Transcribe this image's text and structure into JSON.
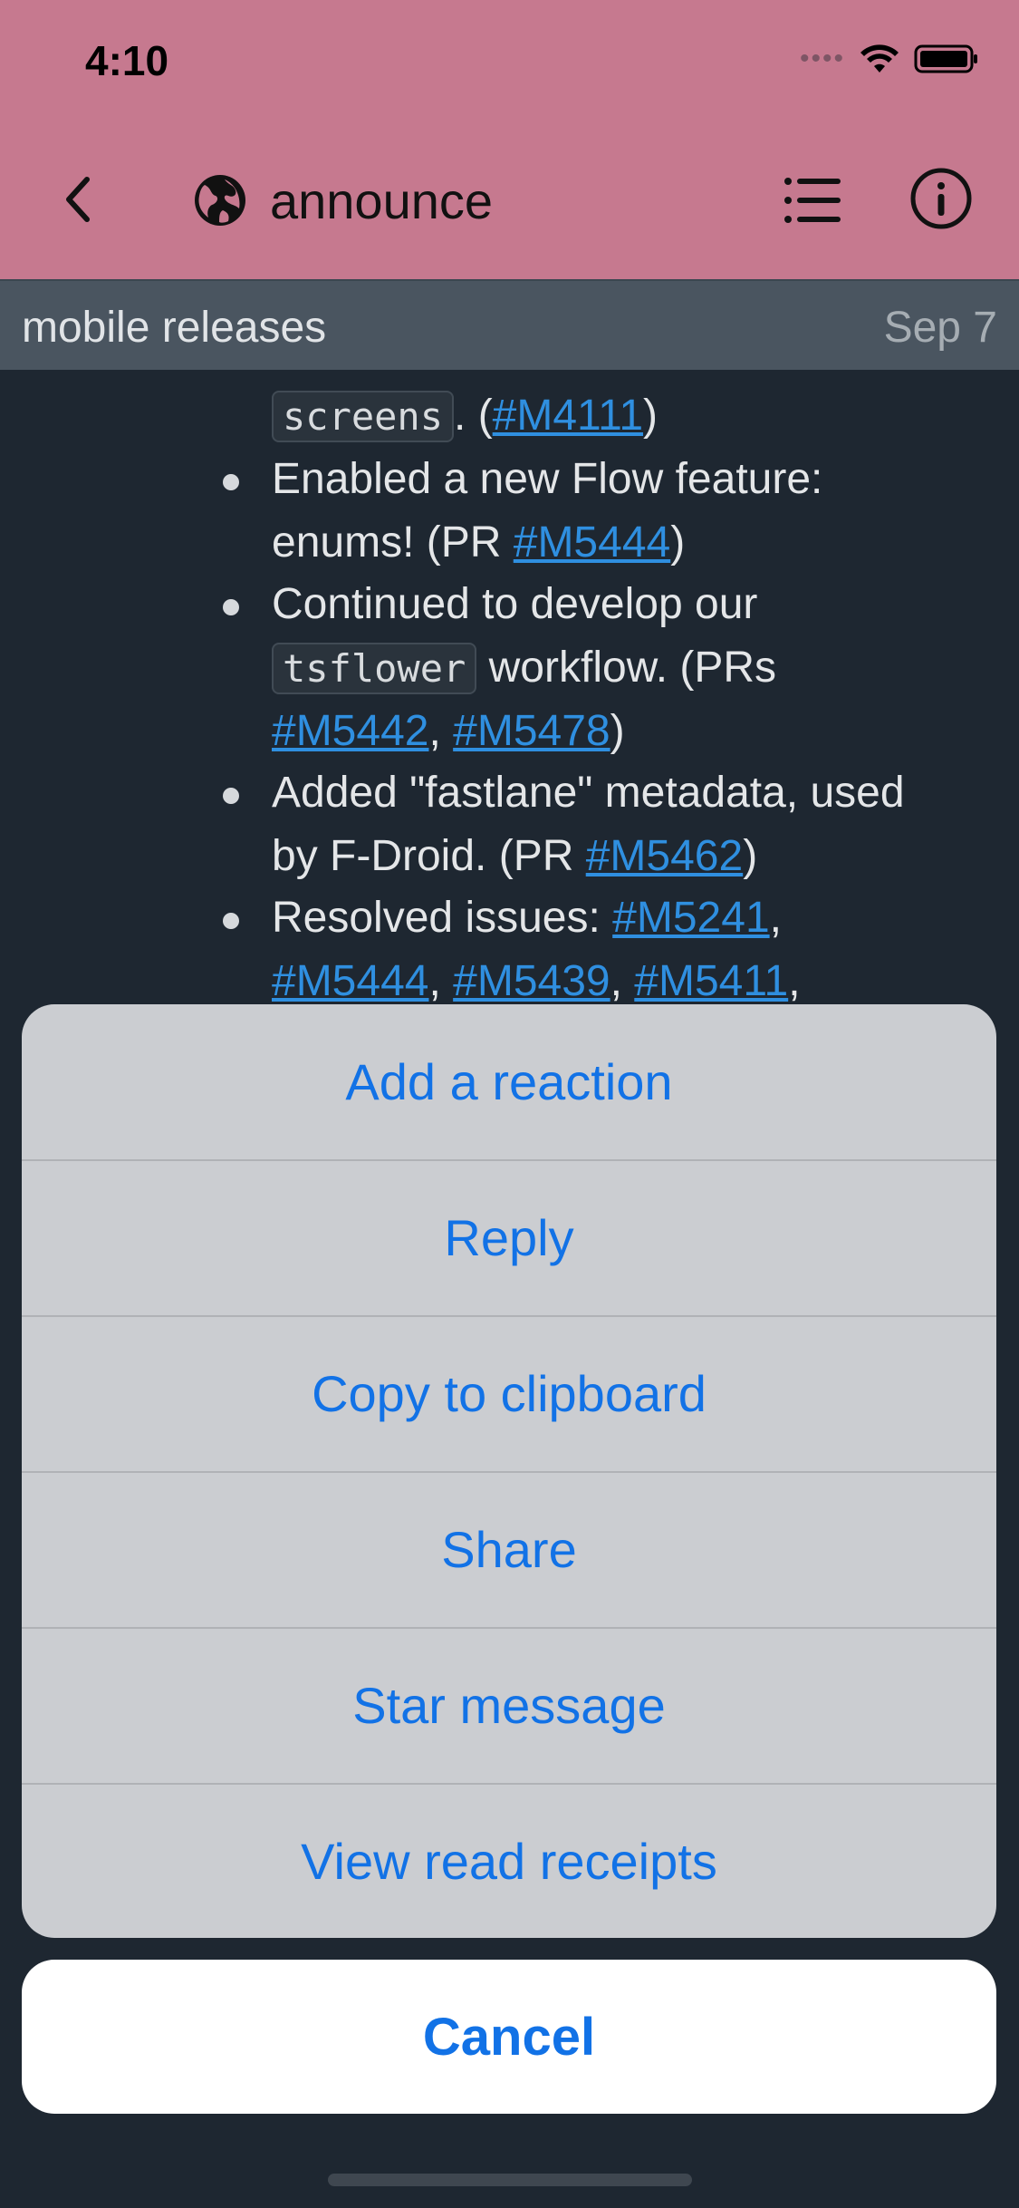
{
  "status": {
    "time": "4:10"
  },
  "nav": {
    "title": "announce"
  },
  "topic": {
    "name": "mobile releases",
    "date": "Sep 7"
  },
  "message": {
    "line0": {
      "code": "screens",
      "pre": ". (",
      "link": "#M4111",
      "post": ")"
    },
    "item1": {
      "line1": "Enabled a new Flow feature:",
      "line2_pre": "enums! (PR ",
      "link": "#M5444",
      "line2_post": ")"
    },
    "item2": {
      "line1": "Continued to develop our",
      "code": "tsflower",
      "line2_post": " workflow. (PRs",
      "link1": "#M5442",
      "sep": ", ",
      "link2": "#M5478",
      "line3_post": ")"
    },
    "item3": {
      "line1": "Added \"fastlane\" metadata, used",
      "line2_pre": "by F-Droid. (PR ",
      "link": "#M5462",
      "line2_post": ")"
    },
    "item4": {
      "pre": "Resolved issues: ",
      "links_a": [
        "#M5241"
      ],
      "links_b": [
        "#M5444",
        "#M5439",
        "#M5411"
      ]
    }
  },
  "actions": [
    "Add a reaction",
    "Reply",
    "Copy to clipboard",
    "Share",
    "Star message",
    "View read receipts"
  ],
  "cancel_label": "Cancel",
  "colors": {
    "header": "#c6798f",
    "accent": "#1272e6",
    "link": "#2f8fe0",
    "background": "#1e2731"
  },
  "icons": {
    "back": "chevron-left-icon",
    "stream": "globe-icon",
    "topics": "list-icon",
    "info": "info-icon"
  }
}
